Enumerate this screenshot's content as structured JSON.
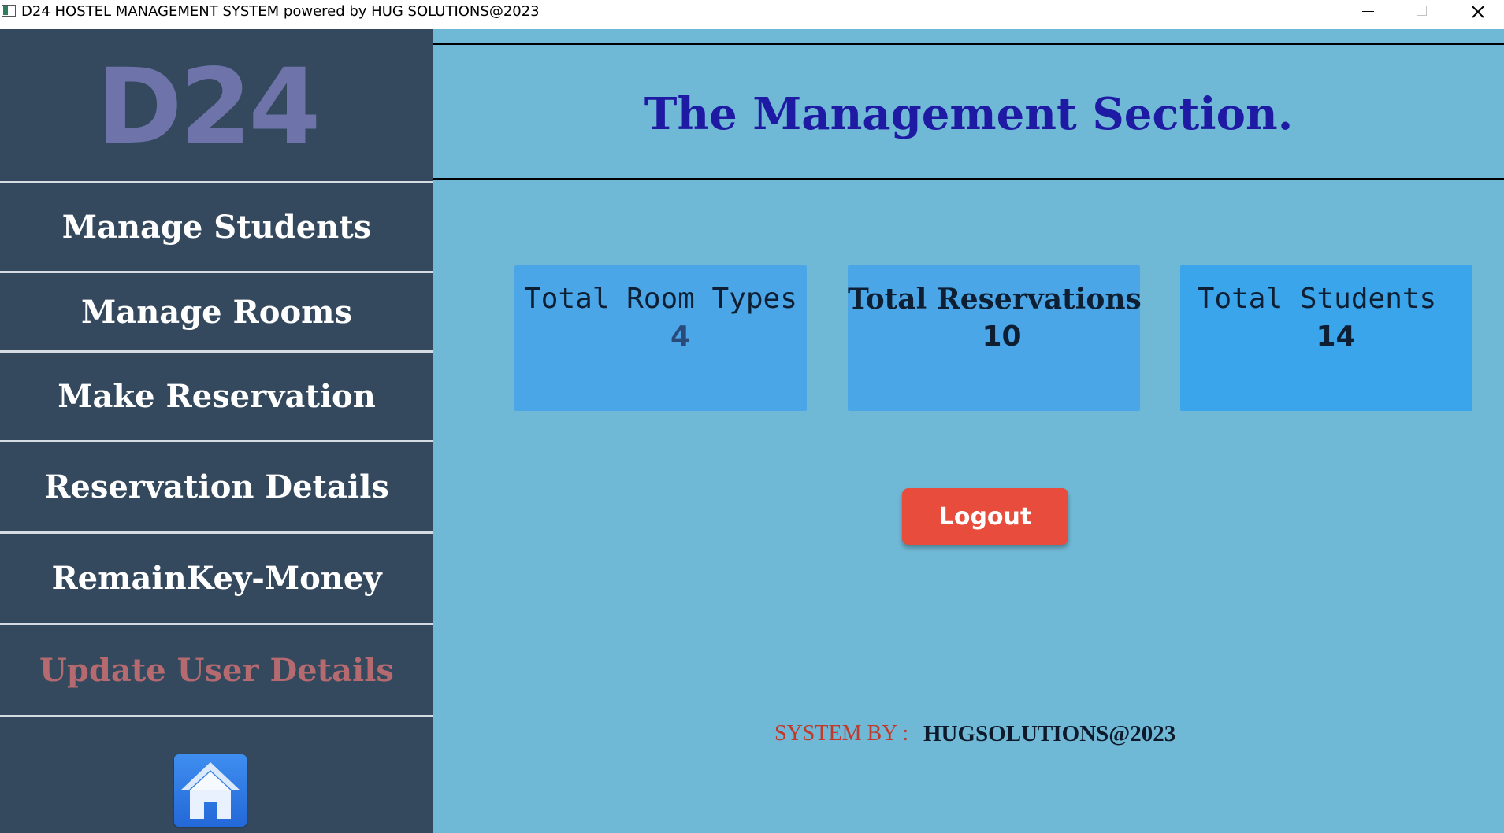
{
  "window": {
    "title": "D24 HOSTEL MANAGEMENT SYSTEM powered by HUG SOLUTIONS@2023"
  },
  "sidebar": {
    "logo": "D24",
    "items": [
      {
        "label": "Manage Students"
      },
      {
        "label": "Manage Rooms"
      },
      {
        "label": "Make Reservation"
      },
      {
        "label": "Reservation Details"
      },
      {
        "label": "RemainKey-Money"
      },
      {
        "label": "Update User Details",
        "active": true
      }
    ],
    "home_icon": "home-icon"
  },
  "main": {
    "heading": "The Management Section.",
    "stats": [
      {
        "label": "Total Room Types",
        "value": "4"
      },
      {
        "label": "Total Reservations",
        "value": "10"
      },
      {
        "label": "Total Students",
        "value": "14"
      }
    ],
    "logout_label": "Logout",
    "footer": {
      "label": "SYSTEM BY :",
      "value": "HUGSOLUTIONS@2023"
    }
  },
  "colors": {
    "sidebar_bg": "#34495e",
    "main_bg": "#70b9d6",
    "heading": "#1f1aa3",
    "card_bg": "#4aa6e6",
    "logout_bg": "#e74c3c",
    "active_item": "#b56a70",
    "logo": "#6e74a9"
  }
}
